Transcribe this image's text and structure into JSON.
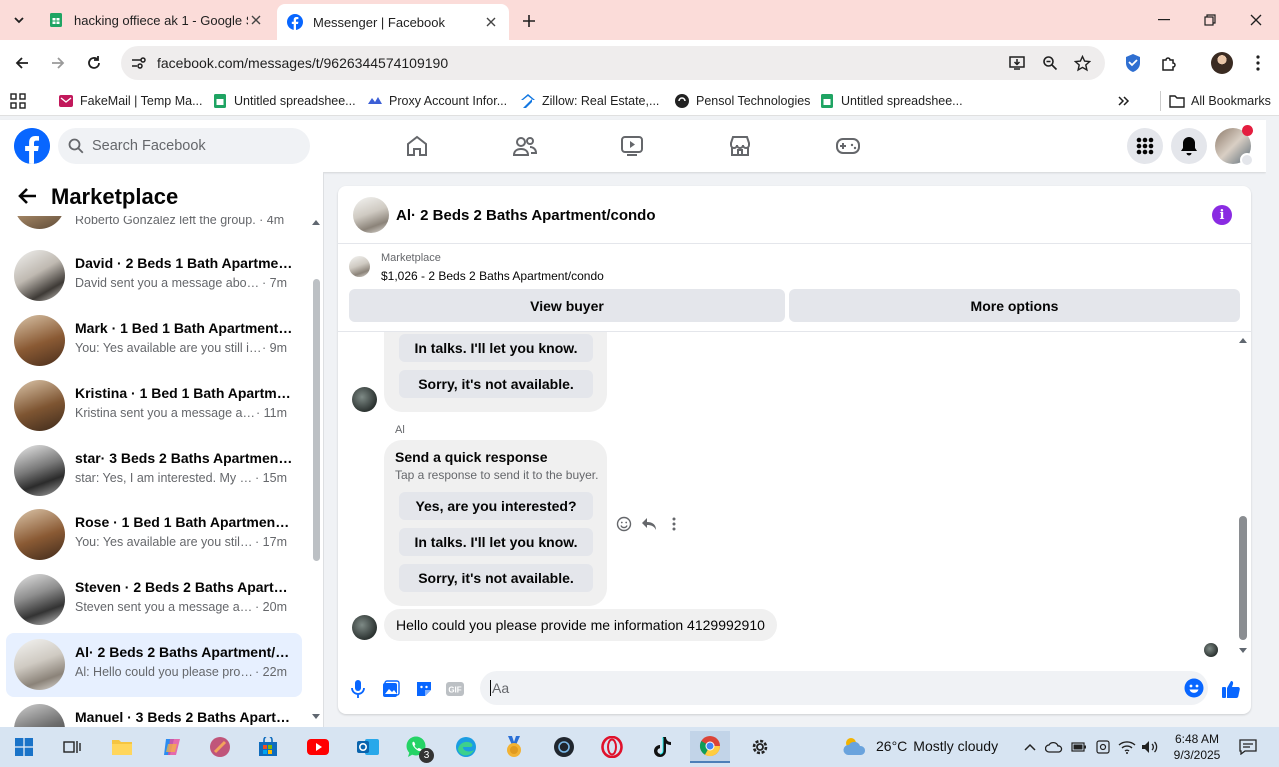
{
  "browser": {
    "tabs": [
      {
        "title": "hacking offiece ak 1 - Google Sh",
        "favicon": "google-sheets-icon"
      },
      {
        "title": "Messenger | Facebook",
        "favicon": "facebook-icon"
      }
    ],
    "url": "facebook.com/messages/t/9626344574109190",
    "bookmarks": [
      {
        "label": "FakeMail | Temp Ma..."
      },
      {
        "label": "Untitled spreadshee..."
      },
      {
        "label": "Proxy Account Infor..."
      },
      {
        "label": "Zillow: Real Estate,..."
      },
      {
        "label": "Pensol Technologies"
      },
      {
        "label": "Untitled spreadshee..."
      }
    ],
    "all_bookmarks": "All Bookmarks"
  },
  "facebook": {
    "search_placeholder": "Search Facebook",
    "brand_color": "#0866ff"
  },
  "sidebar": {
    "title": "Marketplace",
    "first_partial_preview": "Roberto González left the group. · 4m",
    "conversations": [
      {
        "name": "David · 2 Beds 1 Bath Apartment...",
        "preview": "David sent you a message about y...",
        "time": " · 7m"
      },
      {
        "name": "Mark · 1 Bed 1 Bath Apartment/...",
        "preview": "You: Yes available are you still inter...",
        "time": " · 9m"
      },
      {
        "name": "Kristina · 1 Bed 1 Bath Apartmen...",
        "preview": "Kristina sent you a message abo...",
        "time": " · 11m"
      },
      {
        "name": "star· 3 Beds 2 Baths Apartment/...",
        "preview": "star: Yes, I am interested. My nu...",
        "time": " · 15m"
      },
      {
        "name": "Rose · 1 Bed 1 Bath Apartment/c...",
        "preview": "You: Yes available are you still int...",
        "time": " · 17m"
      },
      {
        "name": "Steven · 2 Beds 2 Baths Apartm...",
        "preview": "Steven sent you a message abou...",
        "time": " · 20m"
      },
      {
        "name": "Al· 2 Beds 2 Baths Apartment/c...",
        "preview": "Al: Hello could you please provid...",
        "time": " · 22m"
      },
      {
        "name": "Manuel · 3 Beds 2 Baths Apartm...",
        "preview": "",
        "time": ""
      }
    ]
  },
  "chat": {
    "title": "Al· 2 Beds 2 Baths Apartment/condo",
    "listing_source": "Marketplace",
    "listing_price_title": "$1,026 - 2 Beds 2 Baths Apartment/condo",
    "view_buyer": "View buyer",
    "more_options": "More options",
    "earlier_options": [
      "In talks. I'll let you know.",
      "Sorry, it's not available."
    ],
    "sender": "Al",
    "quick_response_title": "Send a quick response",
    "quick_response_subtitle": "Tap a response to send it to the buyer.",
    "quick_options": [
      "Yes, are you interested?",
      "In talks. I'll let you know.",
      "Sorry, it's not available."
    ],
    "last_message": "Hello could you please provide me information 4129992910",
    "composer_placeholder": "Aa",
    "accent_color": "#0866ff"
  },
  "taskbar": {
    "temperature": "26°C",
    "weather": "Mostly cloudy",
    "time": "6:48 AM",
    "date": "9/3/2025",
    "whatsapp_badge": "3"
  }
}
